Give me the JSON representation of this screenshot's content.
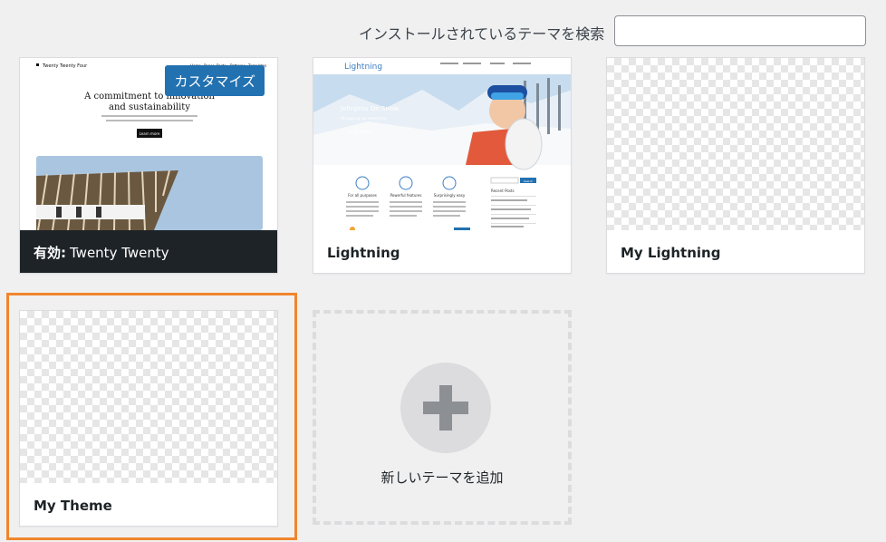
{
  "search": {
    "label": "インストールされているテーマを検索",
    "value": ""
  },
  "themes": [
    {
      "name": "Twenty Twenty",
      "active_prefix": "有効:",
      "customize_label": "カスタマイズ",
      "preview": {
        "nav_brand": "Twenty Twenty Four",
        "nav_links": [
          "Home",
          "Pages",
          "Posts",
          "Patterns",
          "Templates"
        ],
        "headline": [
          "A commitment to innovation",
          "and sustainability"
        ],
        "button": "Learn more"
      }
    },
    {
      "name": "Lightning",
      "preview": {
        "logo": "Lightning",
        "hero_title": "Johnjirou On Snow",
        "hero_sub": "Wrapping up everyone",
        "hero_btn": "READ MORE",
        "features": [
          "For all purposes",
          "Powerful features",
          "Surprisingly easy"
        ],
        "sidebar_title": "Recent Posts",
        "search_btn": "Search"
      }
    },
    {
      "name": "My Lightning"
    },
    {
      "name": "My Theme"
    }
  ],
  "add_new": {
    "label": "新しいテーマを追加",
    "icon": "plus-icon"
  },
  "colors": {
    "accent": "#2271b1",
    "selected_outline": "#f0862d",
    "active_bar": "#1d2327"
  }
}
